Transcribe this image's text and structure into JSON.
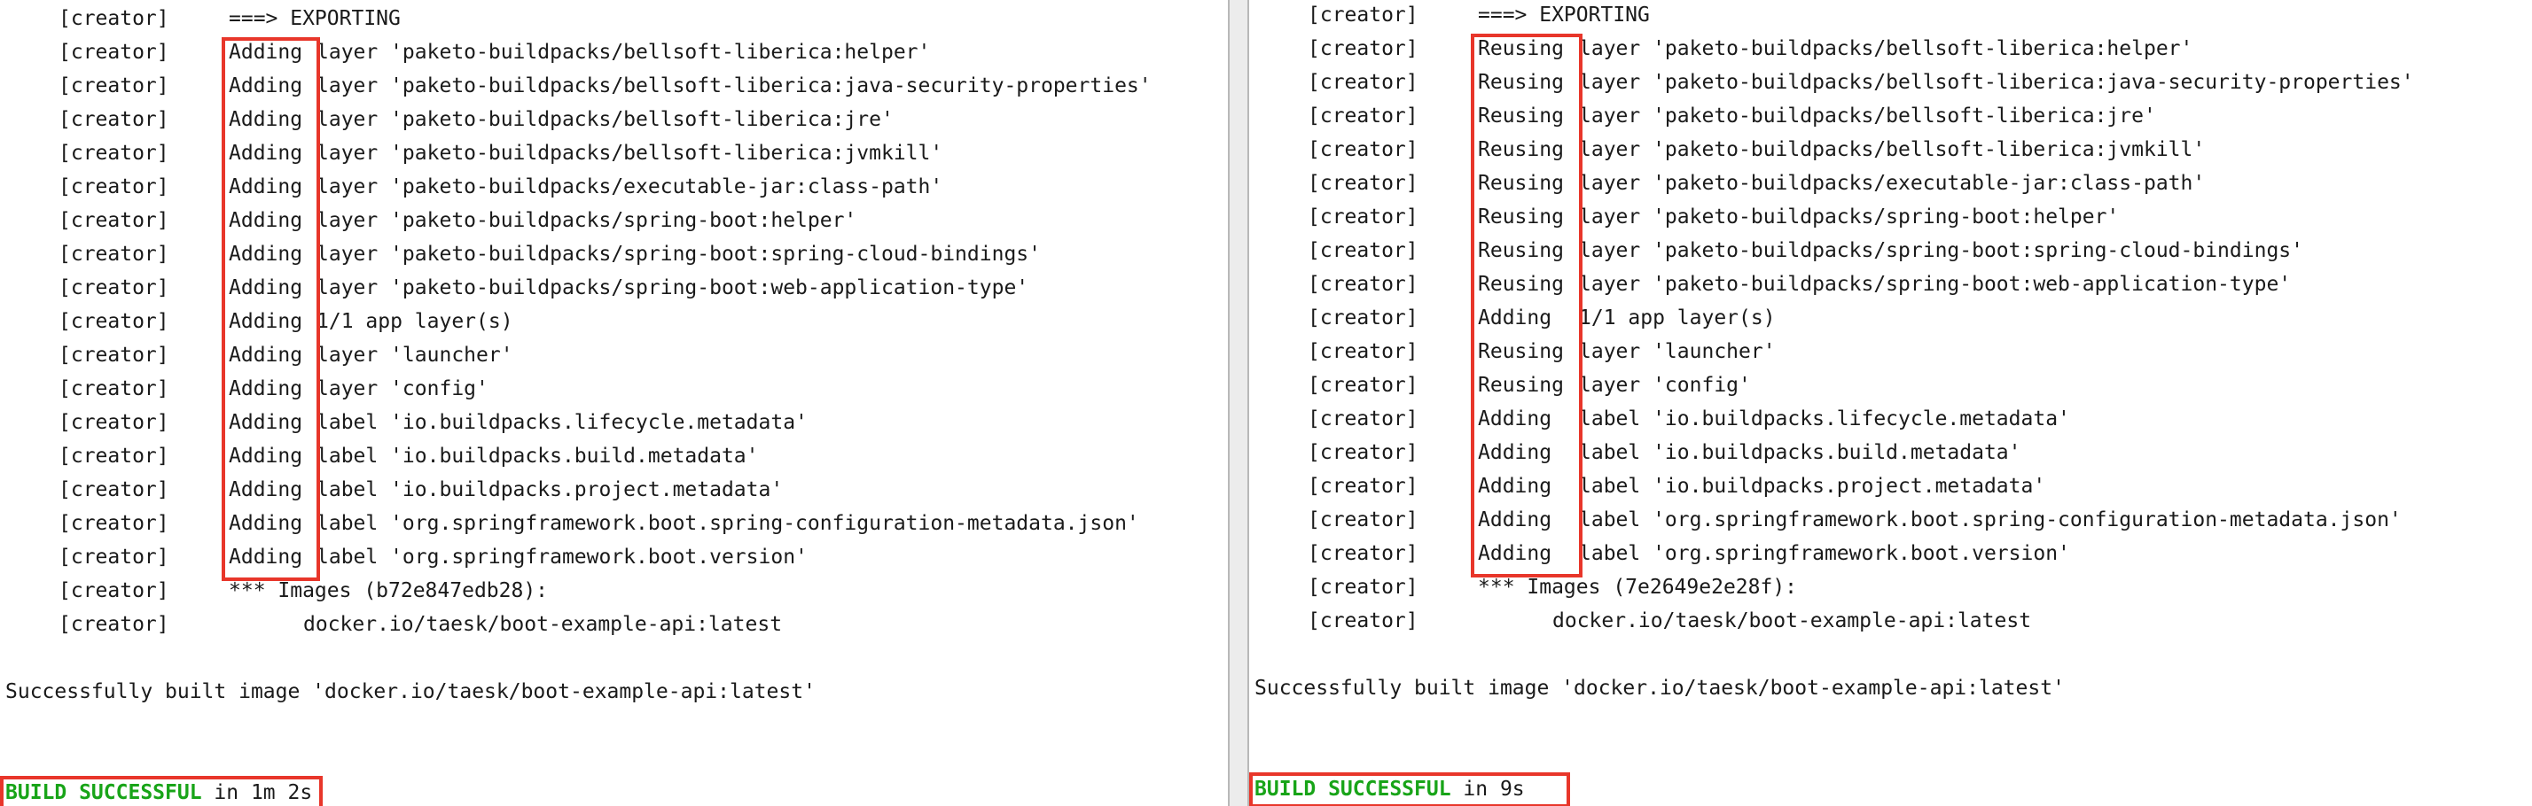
{
  "left": {
    "tag": "[creator]",
    "export_header": "===> EXPORTING",
    "entries": [
      {
        "verb": "Adding",
        "rest": "layer 'paketo-buildpacks/bellsoft-liberica:helper'"
      },
      {
        "verb": "Adding",
        "rest": "layer 'paketo-buildpacks/bellsoft-liberica:java-security-properties'"
      },
      {
        "verb": "Adding",
        "rest": "layer 'paketo-buildpacks/bellsoft-liberica:jre'"
      },
      {
        "verb": "Adding",
        "rest": "layer 'paketo-buildpacks/bellsoft-liberica:jvmkill'"
      },
      {
        "verb": "Adding",
        "rest": "layer 'paketo-buildpacks/executable-jar:class-path'"
      },
      {
        "verb": "Adding",
        "rest": "layer 'paketo-buildpacks/spring-boot:helper'"
      },
      {
        "verb": "Adding",
        "rest": "layer 'paketo-buildpacks/spring-boot:spring-cloud-bindings'"
      },
      {
        "verb": "Adding",
        "rest": "layer 'paketo-buildpacks/spring-boot:web-application-type'"
      },
      {
        "verb": "Adding",
        "rest": "1/1 app layer(s)"
      },
      {
        "verb": "Adding",
        "rest": "layer 'launcher'"
      },
      {
        "verb": "Adding",
        "rest": "layer 'config'"
      },
      {
        "verb": "Adding",
        "rest": "label 'io.buildpacks.lifecycle.metadata'"
      },
      {
        "verb": "Adding",
        "rest": "label 'io.buildpacks.build.metadata'"
      },
      {
        "verb": "Adding",
        "rest": "label 'io.buildpacks.project.metadata'"
      },
      {
        "verb": "Adding",
        "rest": "label 'org.springframework.boot.spring-configuration-metadata.json'"
      },
      {
        "verb": "Adding",
        "rest": "label 'org.springframework.boot.version'"
      }
    ],
    "images_line": "*** Images (b72e847edb28):",
    "image_name": "docker.io/taesk/boot-example-api:latest",
    "built_line": "Successfully built image 'docker.io/taesk/boot-example-api:latest'",
    "build_status": "BUILD SUCCESSFUL",
    "build_time": " in 1m 2s"
  },
  "right": {
    "tag": "[creator]",
    "export_header": "===> EXPORTING",
    "entries": [
      {
        "verb": "Reusing",
        "rest": "layer 'paketo-buildpacks/bellsoft-liberica:helper'"
      },
      {
        "verb": "Reusing",
        "rest": "layer 'paketo-buildpacks/bellsoft-liberica:java-security-properties'"
      },
      {
        "verb": "Reusing",
        "rest": "layer 'paketo-buildpacks/bellsoft-liberica:jre'"
      },
      {
        "verb": "Reusing",
        "rest": "layer 'paketo-buildpacks/bellsoft-liberica:jvmkill'"
      },
      {
        "verb": "Reusing",
        "rest": "layer 'paketo-buildpacks/executable-jar:class-path'"
      },
      {
        "verb": "Reusing",
        "rest": "layer 'paketo-buildpacks/spring-boot:helper'"
      },
      {
        "verb": "Reusing",
        "rest": "layer 'paketo-buildpacks/spring-boot:spring-cloud-bindings'"
      },
      {
        "verb": "Reusing",
        "rest": "layer 'paketo-buildpacks/spring-boot:web-application-type'"
      },
      {
        "verb": "Adding",
        "rest": "1/1 app layer(s)"
      },
      {
        "verb": "Reusing",
        "rest": "layer 'launcher'"
      },
      {
        "verb": "Reusing",
        "rest": "layer 'config'"
      },
      {
        "verb": "Adding",
        "rest": "label 'io.buildpacks.lifecycle.metadata'"
      },
      {
        "verb": "Adding",
        "rest": "label 'io.buildpacks.build.metadata'"
      },
      {
        "verb": "Adding",
        "rest": "label 'io.buildpacks.project.metadata'"
      },
      {
        "verb": "Adding",
        "rest": "label 'org.springframework.boot.spring-configuration-metadata.json'"
      },
      {
        "verb": "Adding",
        "rest": "label 'org.springframework.boot.version'"
      }
    ],
    "images_line": "*** Images (7e2649e2e28f):",
    "image_name": "docker.io/taesk/boot-example-api:latest",
    "built_line": "Successfully built image 'docker.io/taesk/boot-example-api:latest'",
    "build_status": "BUILD SUCCESSFUL",
    "build_time": " in 9s"
  },
  "colors": {
    "highlight_box": "#e8362a",
    "success_text": "#18a418"
  }
}
